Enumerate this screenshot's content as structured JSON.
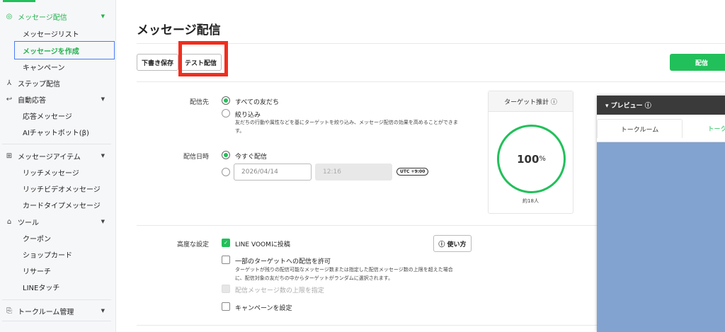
{
  "sidebar": {
    "items": [
      {
        "label": "メッセージ配信",
        "icon": "broadcast-icon",
        "active": true
      },
      {
        "label": "メッセージリスト"
      },
      {
        "label": "メッセージを作成",
        "selected": true
      },
      {
        "label": "キャンペーン"
      },
      {
        "label": "ステップ配信",
        "icon": "step-icon"
      },
      {
        "label": "自動応答",
        "icon": "reply-icon"
      },
      {
        "label": "応答メッセージ"
      },
      {
        "label": "AIチャットボット(β)"
      },
      {
        "label": "メッセージアイテム",
        "icon": "message-item-icon"
      },
      {
        "label": "リッチメッセージ"
      },
      {
        "label": "リッチビデオメッセージ"
      },
      {
        "label": "カードタイプメッセージ"
      },
      {
        "label": "ツール",
        "icon": "store-icon"
      },
      {
        "label": "クーポン"
      },
      {
        "label": "ショップカード"
      },
      {
        "label": "リサーチ"
      },
      {
        "label": "LINEタッチ"
      },
      {
        "label": "トークルーム管理",
        "icon": "chat-room-icon"
      }
    ]
  },
  "main": {
    "title": "メッセージ配信",
    "save_draft": "下書き保存",
    "test_send": "テスト配信",
    "send": "配信",
    "recipient": {
      "label": "配信先",
      "all": "すべての友だち",
      "filter": "絞り込み",
      "filter_desc_1": "友だちの行動や属性などを基にターゲットを絞り込み、メッセージ配信の効果を高めることができま",
      "filter_desc_2": "す。"
    },
    "schedule": {
      "label": "配信日時",
      "now": "今すぐ配信",
      "date": "2026/04/14",
      "time": "12:16",
      "tz": "UTC +9:00"
    },
    "advanced": {
      "label": "高度な設定",
      "voom": "LINE VOOMに投稿",
      "howto": "ⓘ 使い方",
      "partial": "一部のターゲットへの配信を許可",
      "partial_desc_1": "ターゲットが残りの配信可能なメッセージ数または指定した配信メッセージ数の上限を超えた場合",
      "partial_desc_2": "に、配信対象の友だちの中からターゲットがランダムに選択されます。",
      "limit": "配信メッセージ数の上限を指定",
      "campaign": "キャンペーンを設定"
    },
    "target": {
      "title": "ターゲット推計 ⓘ",
      "percent": "100",
      "unit": "%",
      "count": "約18人"
    },
    "preview": {
      "title": "▾ プレビュー ⓘ",
      "tab1": "トークルーム",
      "tab2": "トーク"
    }
  },
  "colors": {
    "accent": "#22c05a",
    "highlight": "#f22d1e"
  }
}
